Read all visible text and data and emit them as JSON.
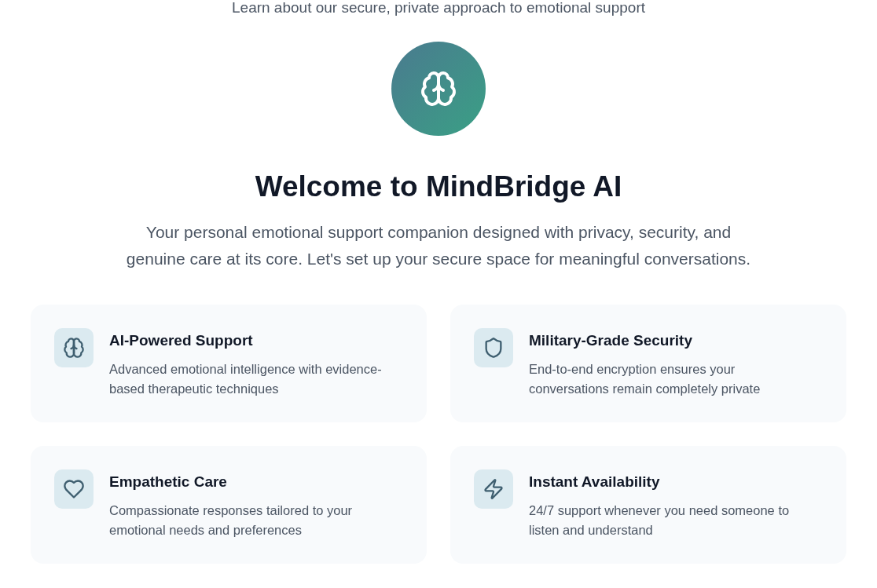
{
  "intro": {
    "subtitle": "Learn about our secure, private approach to emotional support"
  },
  "hero": {
    "title": "Welcome to MindBridge AI",
    "description": "Your personal emotional support companion designed with privacy, security, and genuine care at its core. Let's set up your secure space for meaningful conversations."
  },
  "features": [
    {
      "kind": "brain",
      "title": "AI-Powered Support",
      "description": "Advanced emotional intelligence with evidence-based therapeutic techniques"
    },
    {
      "kind": "shield",
      "title": "Military-Grade Security",
      "description": "End-to-end encryption ensures your conversations remain completely private"
    },
    {
      "kind": "heart",
      "title": "Empathetic Care",
      "description": "Compassionate responses tailored to your emotional needs and preferences"
    },
    {
      "kind": "lightning",
      "title": "Instant Availability",
      "description": "24/7 support whenever you need someone to listen and understand"
    }
  ]
}
